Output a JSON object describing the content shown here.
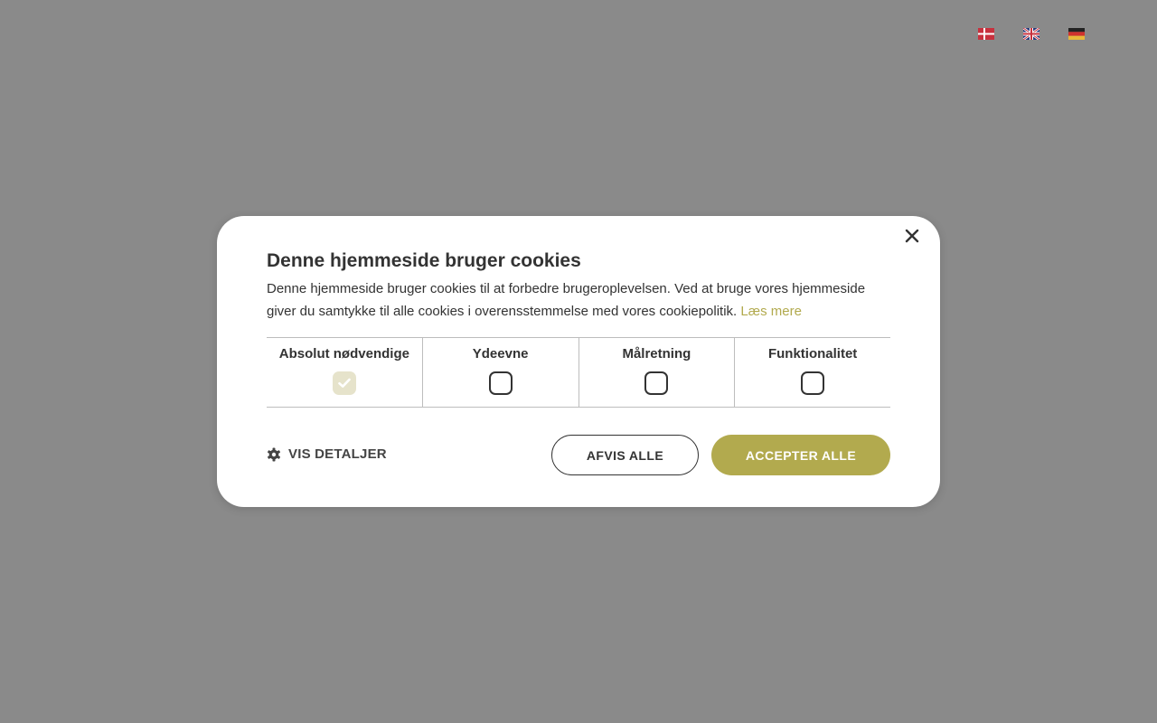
{
  "languages": [
    {
      "code": "da",
      "name": "Dansk"
    },
    {
      "code": "en",
      "name": "English"
    },
    {
      "code": "de",
      "name": "Deutsch"
    }
  ],
  "dialog": {
    "title": "Denne hjemmeside bruger cookies",
    "description": "Denne hjemmeside bruger cookies til at forbedre brugeroplevelsen. Ved at bruge vores hjemmeside giver du samtykke til alle cookies i overensstemmelse med vores cookiepolitik.",
    "read_more": "Læs mere",
    "close_icon": "close-icon",
    "categories": [
      {
        "label": "Absolut nødvendige",
        "checked": true,
        "disabled": true
      },
      {
        "label": "Ydeevne",
        "checked": false
      },
      {
        "label": "Målretning",
        "checked": false
      },
      {
        "label": "Funktionalitet",
        "checked": false
      }
    ],
    "details_label": "VIS DETALJER",
    "details_icon": "gear-icon",
    "decline_label": "AFVIS ALLE",
    "accept_label": "ACCEPTER ALLE"
  },
  "colors": {
    "accent": "#b2aa4e",
    "overlay": "#8a8a8a",
    "text": "#333333",
    "checked_disabled_bg": "#e6e3cb"
  }
}
